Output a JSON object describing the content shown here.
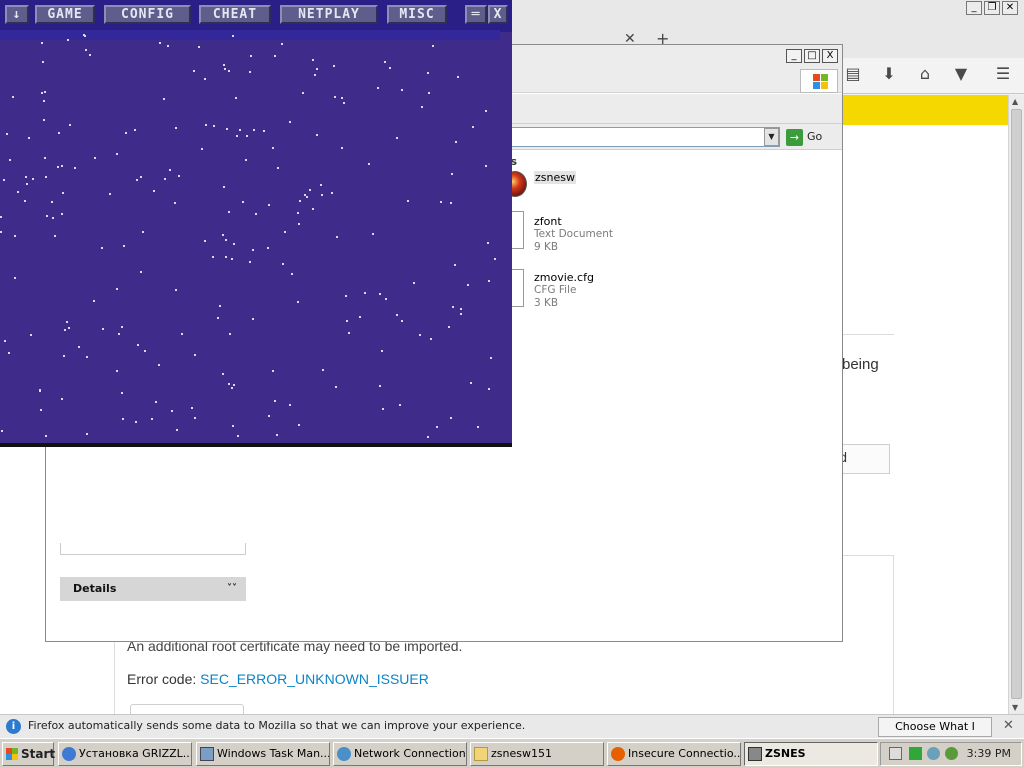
{
  "firefox": {
    "window_buttons": [
      "_",
      "1",
      "X"
    ],
    "tab_close": "✕",
    "new_tab": "+",
    "partial_text_right": "being",
    "partial_button_text": "d",
    "additional_root_text": "An additional root certificate may need to be imported.",
    "error_code_label": "Error code:",
    "error_code_value": "SEC_ERROR_UNKNOWN_ISSUER",
    "notification_text": "Firefox automatically sends some data to Mozilla so that we can improve your experience.",
    "notification_button": "Choose What I Share",
    "notification_close": "✕",
    "icons": [
      "reading-list-icon",
      "downloads-icon",
      "home-icon",
      "pocket-icon",
      "menu-icon"
    ],
    "accent_color": "#f5d800"
  },
  "explorer": {
    "window_buttons": [
      "_",
      "□",
      "X"
    ],
    "go_label": "Go",
    "details_label": "Details",
    "files": [
      {
        "name": "zsnesw",
        "type": "",
        "size": ""
      },
      {
        "name": "zfont",
        "type": "Text Document",
        "size": "9 KB"
      },
      {
        "name": "zmovie.cfg",
        "type": "CFG File",
        "size": "3 KB"
      }
    ],
    "zsnes_icon_label": "es"
  },
  "zsnes": {
    "menu": [
      "↓",
      "GAME",
      "CONFIG",
      "CHEAT",
      "NETPLAY",
      "MISC"
    ],
    "window_buttons": [
      "═",
      "X"
    ],
    "background_color": "#3e2b8a"
  },
  "taskbar": {
    "start_label": "Start",
    "tasks": [
      {
        "label": "Установка GRIZZL...",
        "active": false
      },
      {
        "label": "Windows Task Man...",
        "active": false
      },
      {
        "label": "Network Connections",
        "active": false
      },
      {
        "label": "zsnesw151",
        "active": false
      },
      {
        "label": "Insecure Connectio...",
        "active": false
      },
      {
        "label": "ZSNES",
        "active": true
      }
    ],
    "clock": "3:39 PM"
  }
}
